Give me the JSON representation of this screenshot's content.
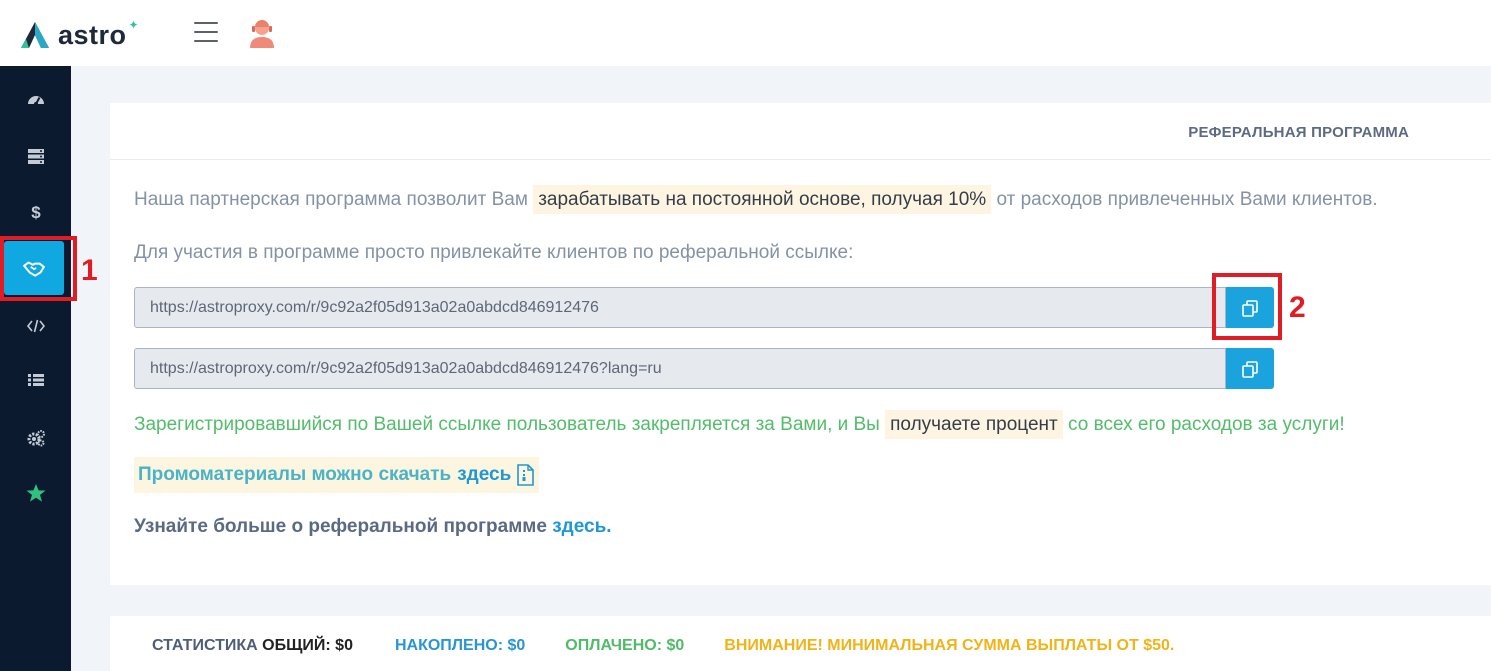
{
  "header": {
    "logo_text": "astro",
    "logo_star": "✦",
    "menu_icon": "hamburger-icon",
    "avatar_icon": "support-operator-avatar-icon"
  },
  "sidebar": {
    "items": [
      {
        "icon": "dashboard-gauge-icon",
        "active": false
      },
      {
        "icon": "servers-icon",
        "active": false
      },
      {
        "icon": "dollar-icon",
        "active": false
      },
      {
        "icon": "handshake-icon",
        "active": true
      },
      {
        "icon": "code-icon",
        "active": false
      },
      {
        "icon": "list-icon",
        "active": false
      },
      {
        "icon": "settings-cogs-icon",
        "active": false
      },
      {
        "icon": "star-icon",
        "active": false
      }
    ]
  },
  "annotations": {
    "label_1": "1",
    "label_2": "2"
  },
  "referral": {
    "title": "РЕФЕРАЛЬНАЯ ПРОГРАММА",
    "intro_before": "Наша партнерская программа позволит Вам ",
    "intro_mark": "зарабатывать на постоянной основе, получая 10%",
    "intro_after": " от расходов привлеченных Вами клиентов.",
    "instruction": "Для участия в программе просто привлекайте клиентов по реферальной ссылке:",
    "link_1": "https://astroproxy.com/r/9c92a2f05d913a02a0abdcd846912476",
    "link_2": "https://astroproxy.com/r/9c92a2f05d913a02a0abdcd846912476?lang=ru",
    "registered_before": "Зарегистрировавшийся по Вашей ссылке пользователь закрепляется за Вами, и Вы ",
    "registered_mark": "получаете процент",
    "registered_after": " со всех его расходов за услуги!",
    "promo_text": "Промоматериалы можно скачать",
    "promo_link": "здесь",
    "more_text": "Узнайте больше о реферальной программе ",
    "more_link": "здесь",
    "more_dot": "."
  },
  "stats": {
    "label": "СТАТИСТИКА",
    "total": "ОБЩИЙ: $0",
    "accumulated": "НАКОПЛЕНО: $0",
    "paid": "ОПЛАЧЕНО: $0",
    "warning": "ВНИМАНИЕ! МИНИМАЛЬНАЯ СУММА ВЫПЛАТЫ ОТ $50."
  },
  "colors": {
    "sidebar_bg": "#0c1a30",
    "accent": "#1aa3dd",
    "highlight_red": "#e01c24",
    "success_green": "#52bd6a",
    "warning_yellow": "#f0b418"
  }
}
